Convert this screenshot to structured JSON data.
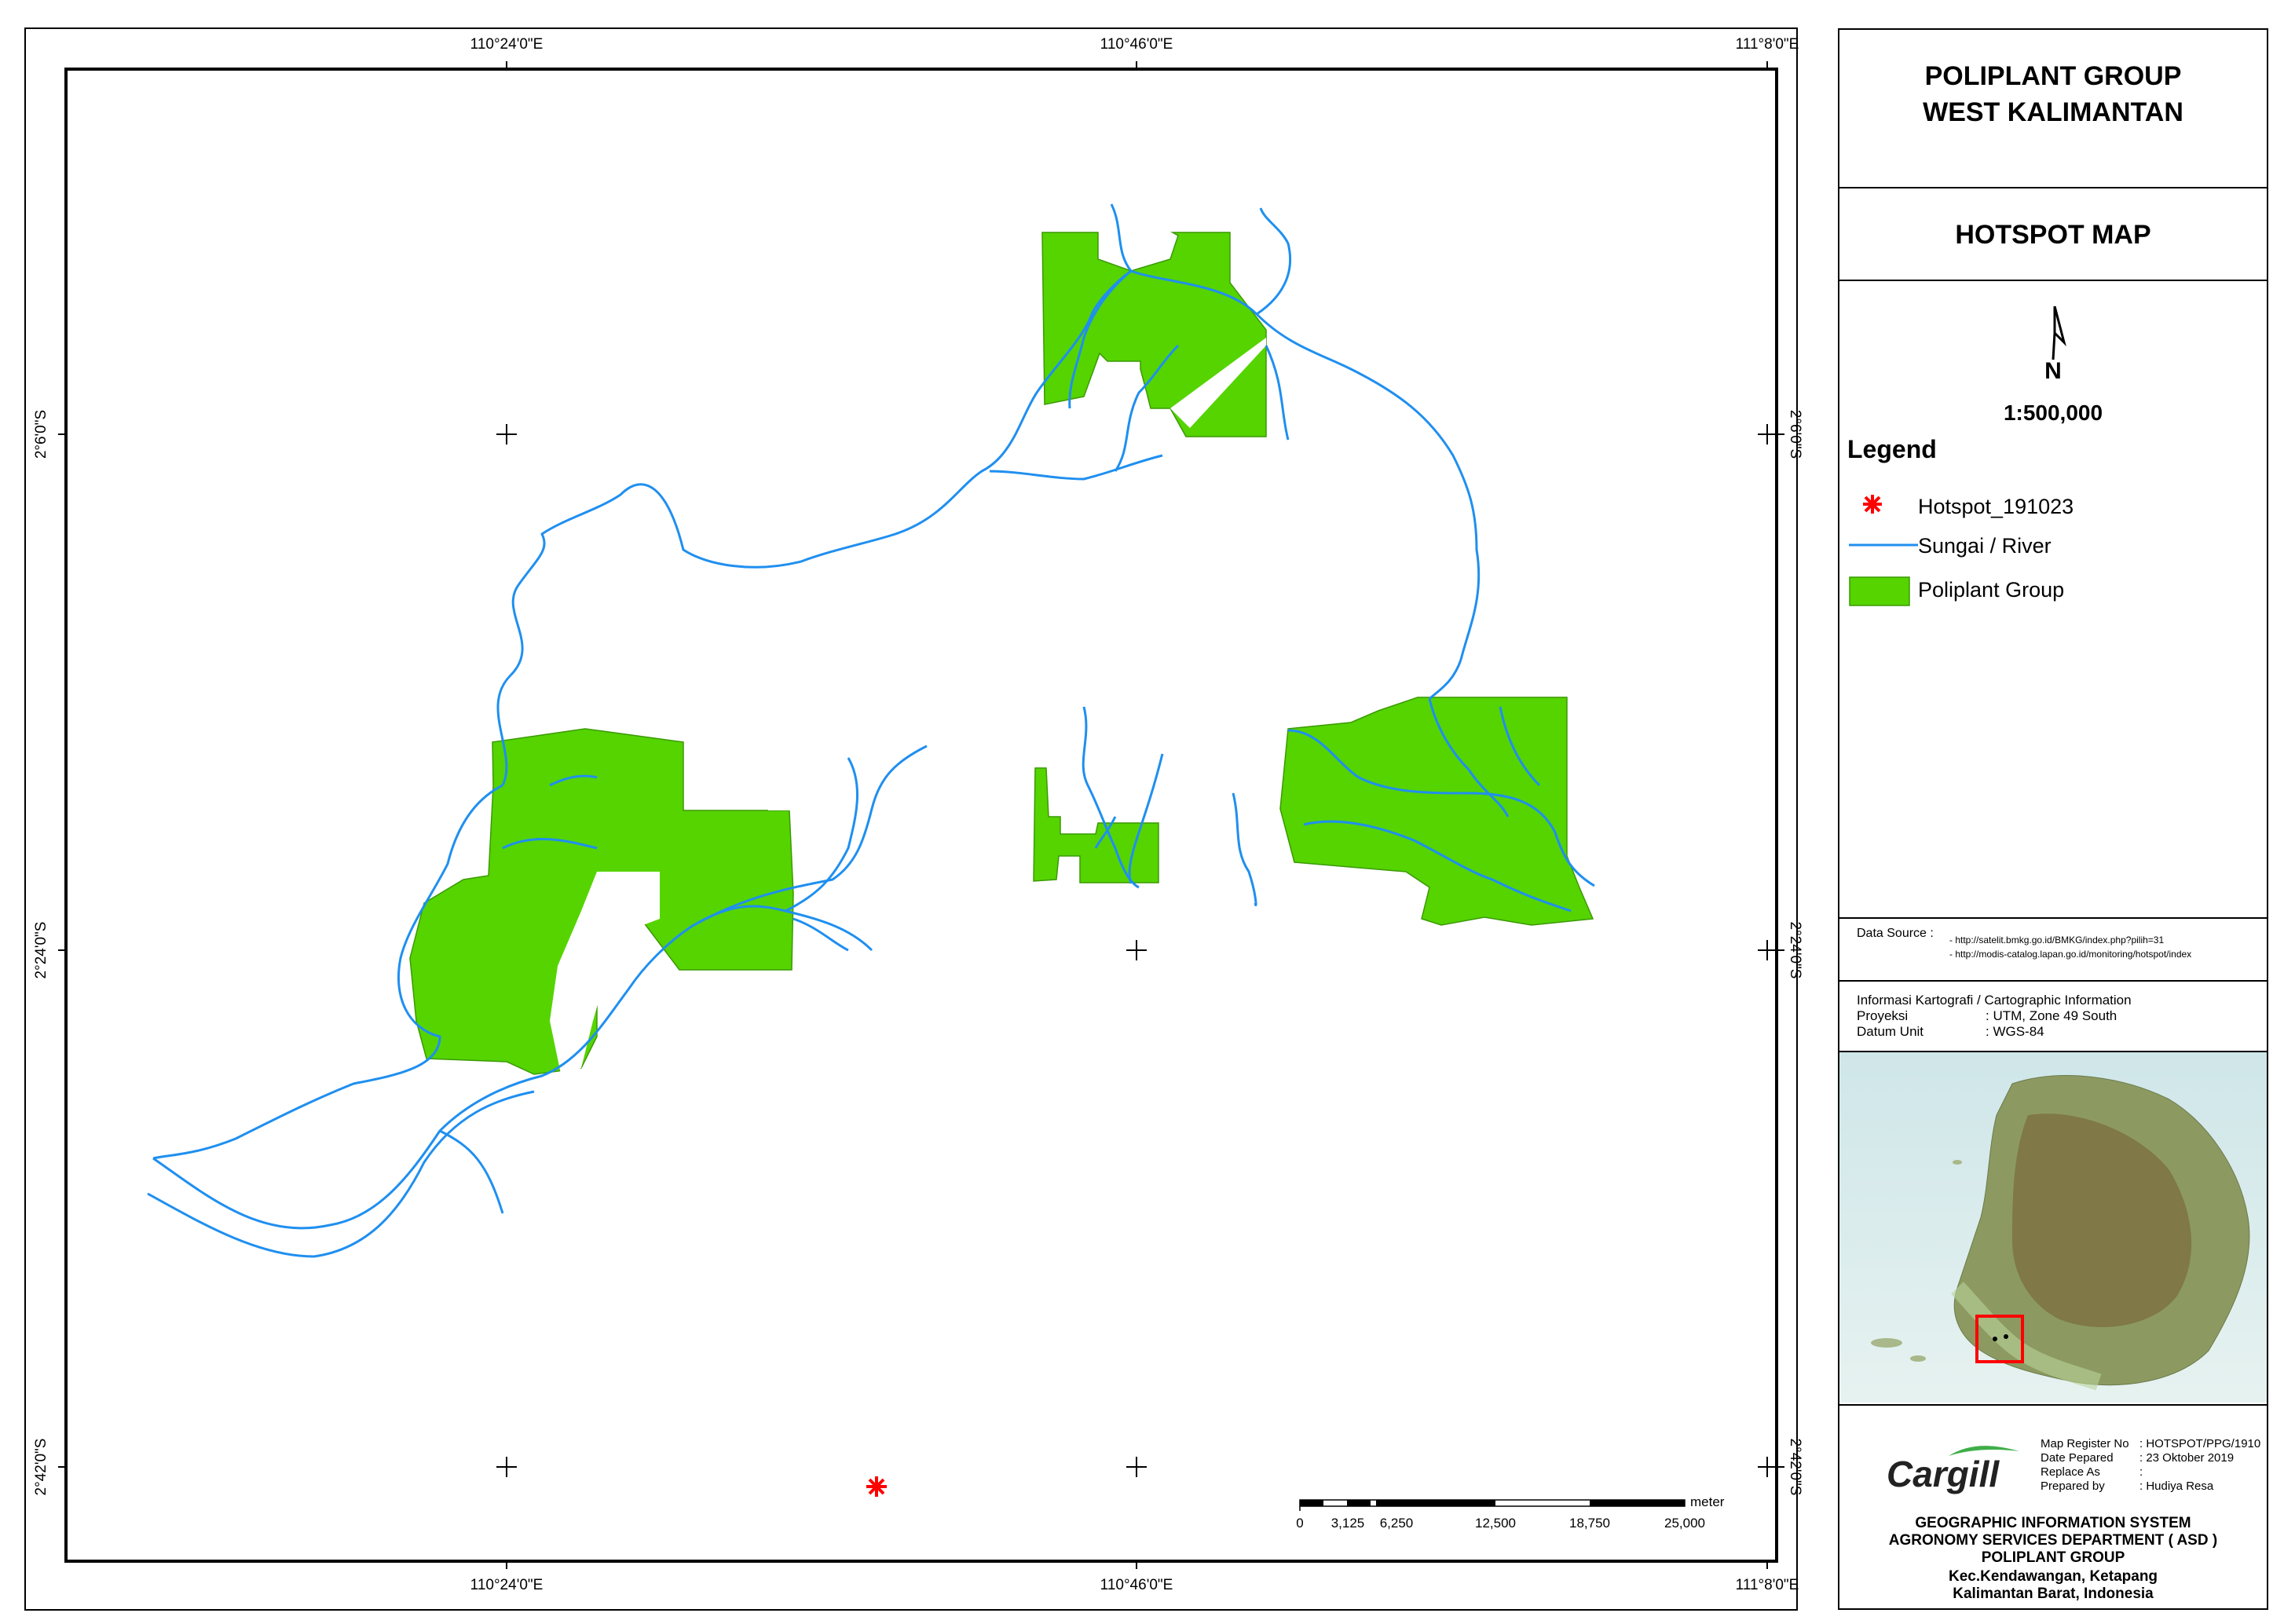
{
  "map": {
    "coord_labels_top": [
      "110°24'0\"E",
      "110°46'0\"E",
      "111°8'0\"E"
    ],
    "coord_labels_bottom": [
      "110°24'0\"E",
      "110°46'0\"E",
      "111°8'0\"E"
    ],
    "coord_labels_left": [
      "2°6'0\"S",
      "2°24'0\"S",
      "2°42'0\"S"
    ],
    "coord_labels_right": [
      "2°6'0\"S",
      "2°24'0\"S",
      "2°42'0\"S"
    ],
    "scale_bar": {
      "labels": [
        "0",
        "3,125",
        "6,250",
        "12,500",
        "18,750",
        "25,000"
      ],
      "unit": "meter"
    },
    "colors": {
      "river": "#1f8ff0",
      "plantation": "#55d400",
      "hotspot": "#ff0000"
    }
  },
  "panel": {
    "title_line1": "POLIPLANT GROUP",
    "title_line2": "WEST KALIMANTAN",
    "subtitle": "HOTSPOT MAP",
    "north_letter": "N",
    "scale": "1:500,000",
    "legend": {
      "title": "Legend",
      "items": [
        {
          "label": "Hotspot_191023",
          "symbol": "red-asterisk"
        },
        {
          "label": "Sungai / River",
          "symbol": "blue-line"
        },
        {
          "label": "Poliplant Group",
          "symbol": "green-box"
        }
      ]
    },
    "data_source": {
      "label": "Data Source :",
      "urls": [
        "- http://satelit.bmkg.go.id/BMKG/index.php?pilih=31",
        "- http://modis-catalog.lapan.go.id/monitoring/hotspot/index"
      ]
    },
    "carto": {
      "heading": "Informasi Kartografi / Cartographic Information",
      "rows": [
        {
          "key": "Proyeksi",
          "value": ": UTM, Zone 49 South"
        },
        {
          "key": "Datum Unit",
          "value": ": WGS-84"
        }
      ]
    },
    "footer": {
      "logo": "Cargill",
      "meta": [
        {
          "key": "Map Register No",
          "value": ": HOTSPOT/PPG/1910"
        },
        {
          "key": "Date Pepared",
          "value": ": 23 Oktober 2019"
        },
        {
          "key": "Replace As",
          "value": ":"
        },
        {
          "key": "Prepared by",
          "value": ": Hudiya Resa"
        }
      ],
      "lines": [
        "GEOGRAPHIC INFORMATION SYSTEM",
        "AGRONOMY SERVICES DEPARTMENT ( ASD )",
        "POLIPLANT GROUP",
        "Kec.Kendawangan, Ketapang",
        "Kalimantan Barat, Indonesia"
      ]
    }
  }
}
